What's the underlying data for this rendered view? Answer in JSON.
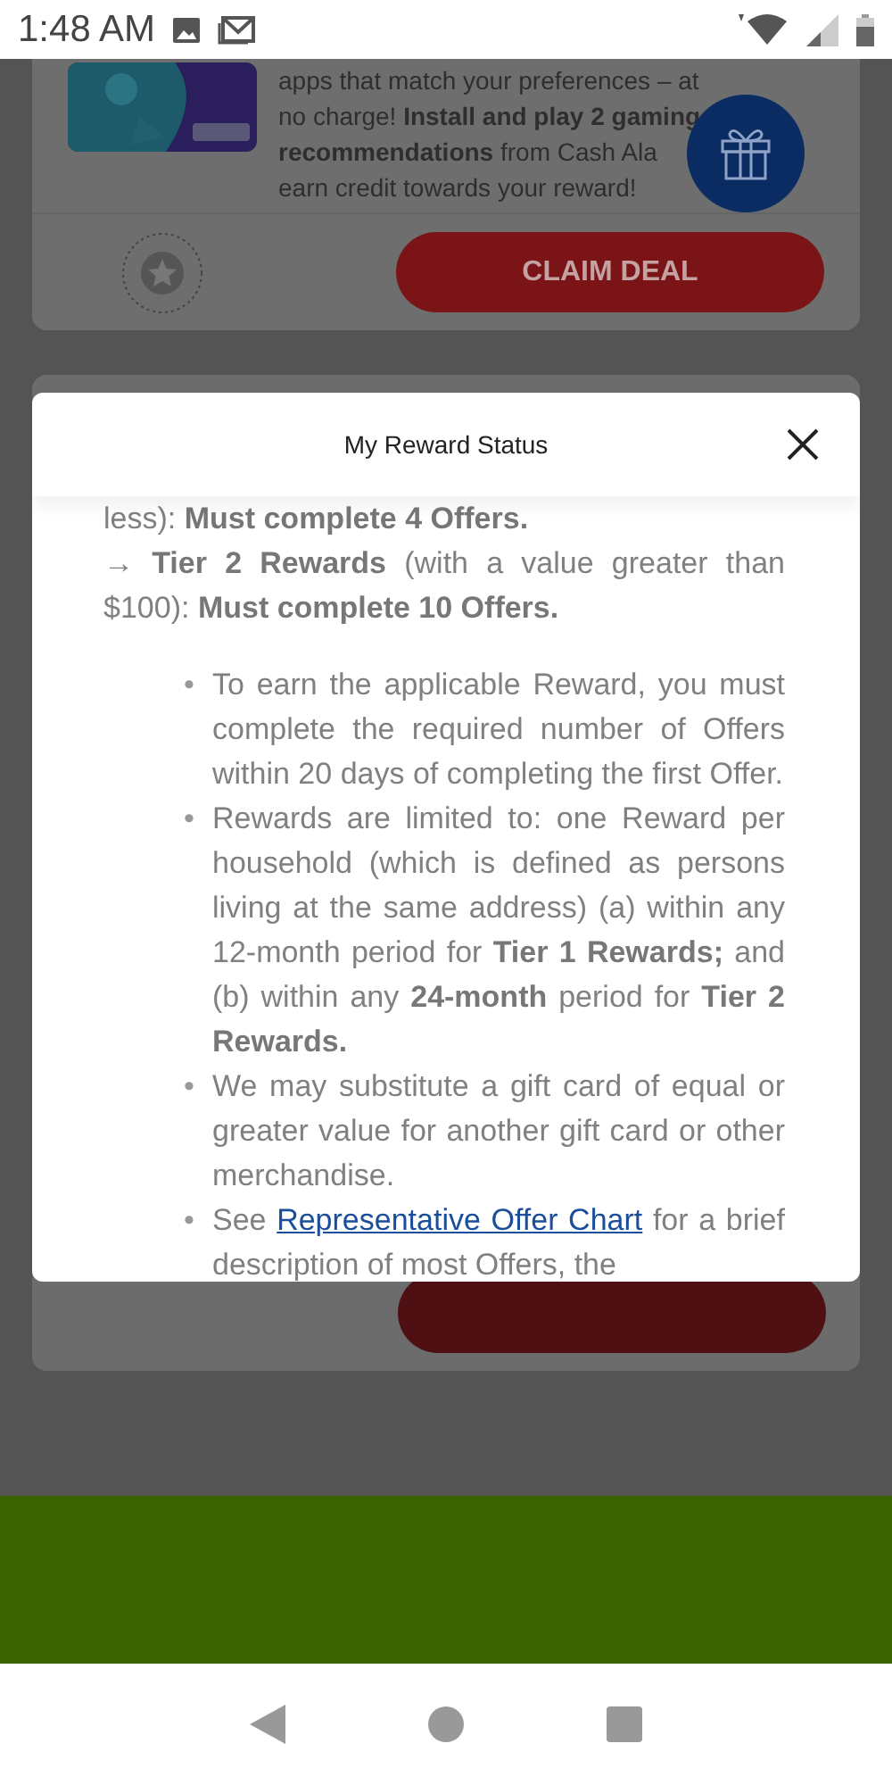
{
  "status_bar": {
    "time": "1:48 AM"
  },
  "offer_card": {
    "description": "apps that match your preferences – at no charge! **Install and play 2 gaming** **recommendations** from Cash Ala earn credit towards your reward!",
    "claim_button": "CLAIM DEAL"
  },
  "modal": {
    "title": "My Reward Status",
    "paragraphs": [
      "less): **Must complete 4 Offers.**",
      "→ **Tier 2 Rewards** (with a value greater than $100): **Must complete 10 Offers.**"
    ],
    "bullets": [
      {
        "kind": "text",
        "marker": "•",
        "text": "To earn the applicable Reward, you must complete the required number of Offers within 20 days of completing the first Offer."
      },
      {
        "kind": "text",
        "marker": "•",
        "text": "Rewards are limited to:  one Reward per household (which is defined as persons living at the same address) (a) within any 12-month period for **Tier 1 Rewards;** and (b) within any **24-month** period for **Tier 2 Rewards.**"
      },
      {
        "kind": "text",
        "marker": "•",
        "text": "We may substitute a gift card of equal or greater value for another gift card or other merchandise."
      },
      {
        "kind": "link",
        "marker": "•",
        "before": "See",
        "link": "Representative Offer Chart",
        "after": "for a brief description of most Offers, the"
      }
    ]
  }
}
